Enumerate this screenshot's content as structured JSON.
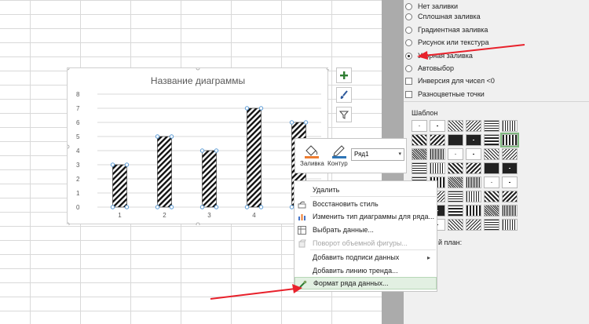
{
  "fill_options": [
    {
      "label": "Нет заливки",
      "checked": false
    },
    {
      "label": "Сплошная заливка",
      "checked": false
    },
    {
      "label": "Градиентная заливка",
      "checked": false
    },
    {
      "label": "Рисунок или текстура",
      "checked": false
    },
    {
      "label": "Узорная заливка",
      "checked": true
    },
    {
      "label": "Автовыбор",
      "checked": false
    }
  ],
  "checkboxes": [
    {
      "label": "Инверсия для чисел <0",
      "checked": false
    },
    {
      "label": "Разноцветные точки",
      "checked": false
    }
  ],
  "pattern_section": {
    "label": "Шаблон",
    "background_label": "й план:"
  },
  "chart_data": {
    "type": "bar",
    "title": "Название диаграммы",
    "categories": [
      "1",
      "2",
      "3",
      "4",
      "5"
    ],
    "series": [
      {
        "values": [
          3,
          5,
          4,
          7,
          6
        ]
      }
    ],
    "ylim": [
      0,
      8
    ],
    "yticks": [
      "0",
      "1",
      "2",
      "3",
      "4",
      "5",
      "6",
      "7",
      "8"
    ],
    "grid": true,
    "bar_fill": "diagonal-hatch",
    "selected": true
  },
  "chart_side_buttons": [
    {
      "icon": "plus-icon"
    },
    {
      "icon": "brush-icon"
    },
    {
      "icon": "filter-icon"
    }
  ],
  "mini_toolbar": {
    "fill_label": "Заливка",
    "outline_label": "Контур",
    "series_value": "Ряд1"
  },
  "context_menu": [
    {
      "label": "Удалить",
      "icon": "",
      "disabled": false
    },
    {
      "label": "Восстановить стиль",
      "icon": "reset-style-icon",
      "disabled": false
    },
    {
      "label": "Изменить тип диаграммы для ряда...",
      "icon": "chart-type-icon",
      "disabled": false
    },
    {
      "label": "Выбрать данные...",
      "icon": "select-data-icon",
      "disabled": false
    },
    {
      "label": "Поворот объемной фигуры...",
      "icon": "rotate-3d-icon",
      "disabled": true
    },
    {
      "label": "Добавить подписи данных",
      "icon": "",
      "disabled": false,
      "submenu": true
    },
    {
      "label": "Добавить линию тренда...",
      "icon": "",
      "disabled": false
    },
    {
      "label": "Формат ряда данных...",
      "icon": "format-series-icon",
      "disabled": false,
      "highlighted": true
    }
  ],
  "colors": {
    "accent_arrow": "#e8212b",
    "selection_handle": "#5b9bd5",
    "highlight": "#e2f0e2"
  }
}
